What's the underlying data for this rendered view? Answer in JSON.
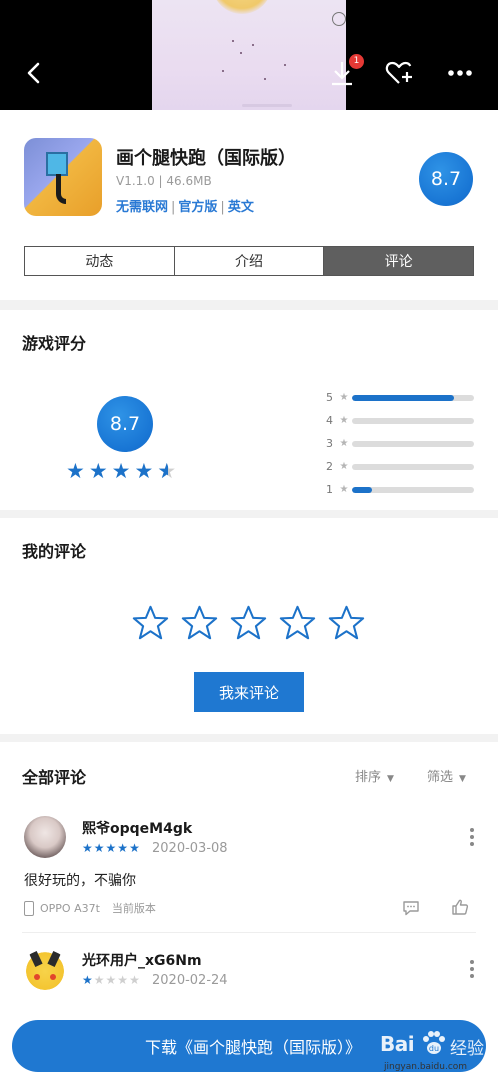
{
  "header": {
    "download_badge": "1"
  },
  "app": {
    "name": "画个腿快跑（国际版）",
    "meta": "V1.1.0 | 46.6MB",
    "tags": [
      "无需联网",
      "官方版",
      "英文"
    ],
    "score": "8.7"
  },
  "tabs": [
    {
      "label": "动态",
      "active": false
    },
    {
      "label": "介绍",
      "active": false
    },
    {
      "label": "评论",
      "active": true
    }
  ],
  "rating": {
    "title": "游戏评分",
    "score": "8.7",
    "stars": 4.5,
    "distribution": [
      {
        "label": "5",
        "fraction": 0.84
      },
      {
        "label": "4",
        "fraction": 0.0
      },
      {
        "label": "3",
        "fraction": 0.0
      },
      {
        "label": "2",
        "fraction": 0.0
      },
      {
        "label": "1",
        "fraction": 0.16
      }
    ]
  },
  "my_review": {
    "title": "我的评论",
    "button": "我来评论"
  },
  "all_comments": {
    "title": "全部评论",
    "sort_label": "排序",
    "filter_label": "筛选",
    "comments": [
      {
        "user": "熙爷opqeM4gk",
        "stars": 5,
        "date": "2020-03-08",
        "text": "很好玩的，不骗你",
        "device": "OPPO A37t",
        "version": "当前版本"
      },
      {
        "user": "光环用户_xG6Nm",
        "stars": 1,
        "date": "2020-02-24"
      }
    ]
  },
  "download": {
    "label": "下载《画个腿快跑（国际版）》"
  },
  "watermark": {
    "brand": "Bai",
    "product": "经验",
    "url": "jingyan.baidu.com"
  },
  "colors": {
    "accent": "#1f78d1",
    "star": "#1c72c9",
    "tab_active": "#5f5f5f"
  }
}
